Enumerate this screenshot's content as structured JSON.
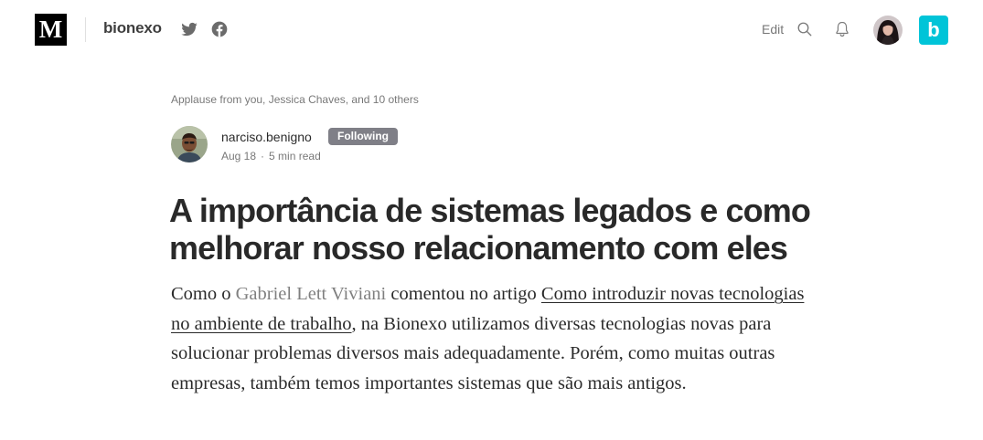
{
  "topbar": {
    "logo_letter": "M",
    "publication_name": "bionexo",
    "edit_label": "Edit",
    "publication_logo_letter": "b",
    "publication_logo_color": "#00c4d8",
    "icons": [
      "twitter-icon",
      "facebook-icon",
      "search-icon",
      "bell-icon"
    ]
  },
  "article": {
    "applause_text": "Applause from you, Jessica Chaves, and 10 others",
    "author": {
      "name": "narciso.benigno",
      "follow_label": "Following",
      "date": "Aug 18",
      "separator": "·",
      "read_time": "5 min read"
    },
    "title": "A importância de sistemas legados e como melhorar nosso relacionamento com eles",
    "body": {
      "intro_text": "Como o ",
      "mention": "Gabriel Lett Viviani",
      "middle_text": " comentou no artigo ",
      "link_text": "Como introduzir novas tecnologias no ambiente de trabalho",
      "rest_text": ", na Bionexo utilizamos diversas tecnologias novas para solucionar problemas diversos mais adequadamente. Porém, como muitas outras empresas, também temos importantes sistemas que são mais antigos."
    }
  }
}
